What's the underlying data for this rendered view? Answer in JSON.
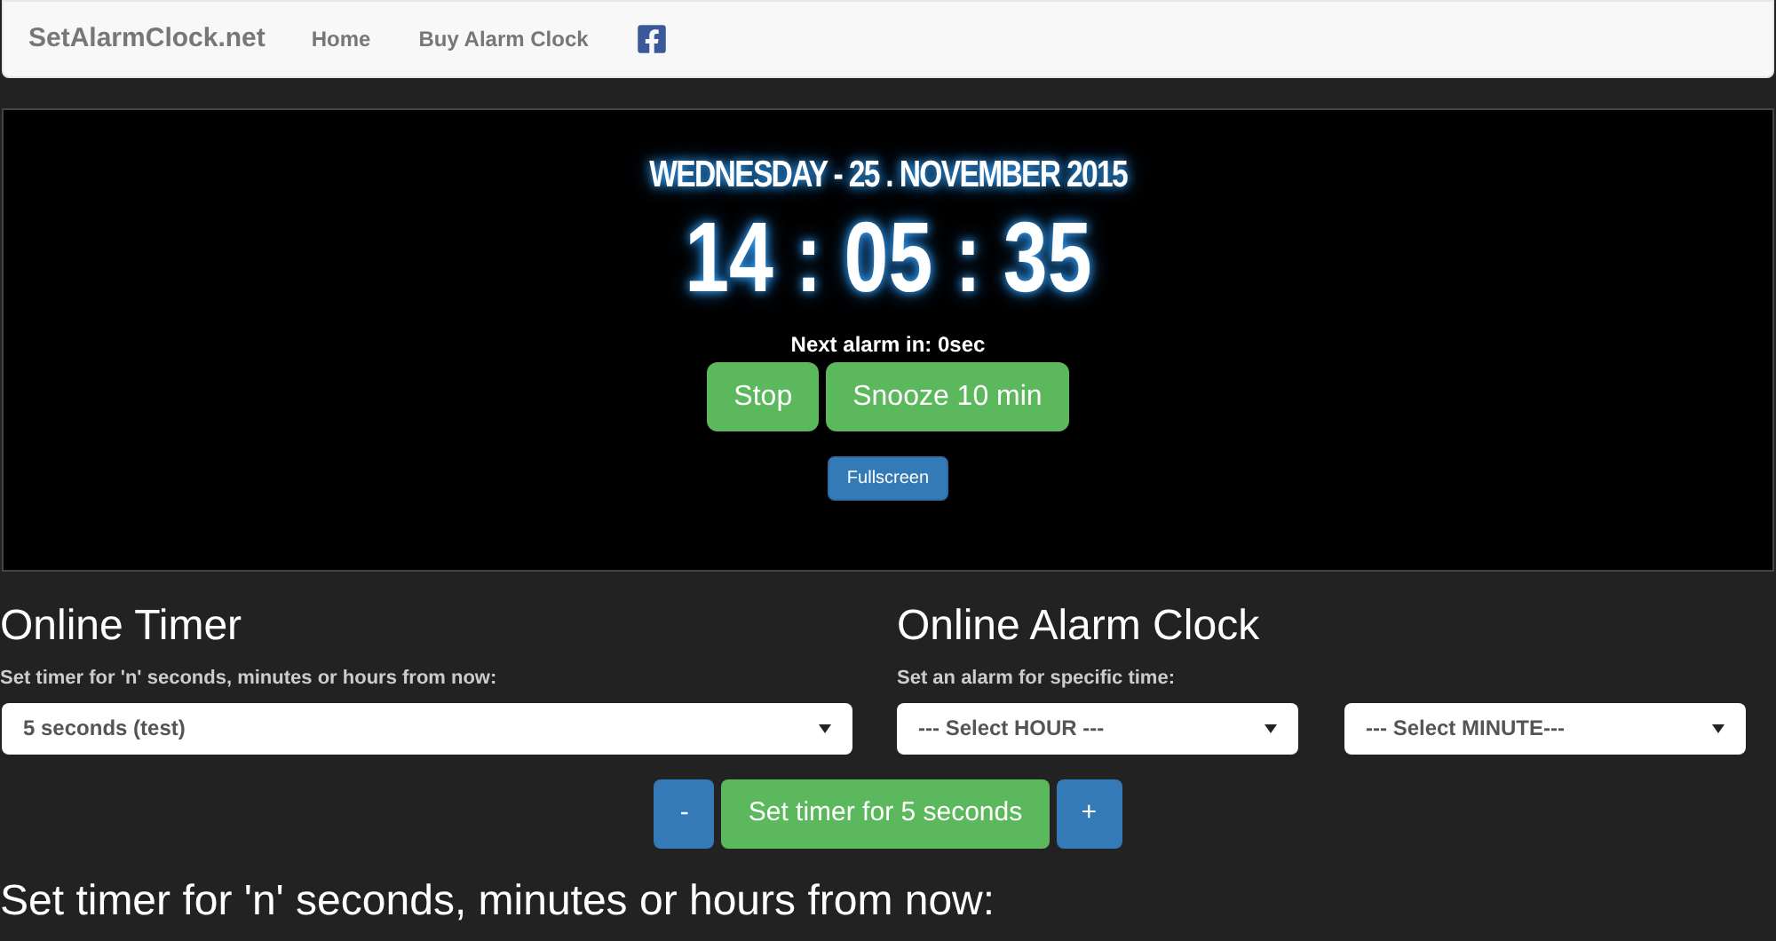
{
  "navbar": {
    "brand": "SetAlarmClock.net",
    "links": [
      "Home",
      "Buy Alarm Clock"
    ]
  },
  "clock": {
    "date": "WEDNESDAY - 25 . NOVEMBER 2015",
    "time": "14 : 05 : 35",
    "next_alarm": "Next alarm in: 0sec",
    "buttons": [
      "Stop",
      "Snooze 10 min"
    ],
    "fullscreen": "Fullscreen"
  },
  "timer": {
    "title": "Online Timer",
    "label": "Set timer for 'n' seconds, minutes or hours from now:",
    "select": "5 seconds (test)"
  },
  "alarm": {
    "title": "Online Alarm Clock",
    "label": "Set an alarm for specific time:",
    "selects": [
      "--- Select HOUR ---",
      "--- Select MINUTE---"
    ]
  },
  "controls": {
    "minus": "-",
    "set": "Set timer for 5 seconds",
    "plus": "+"
  },
  "heading": "Set timer for 'n' seconds, minutes or hours from now:"
}
